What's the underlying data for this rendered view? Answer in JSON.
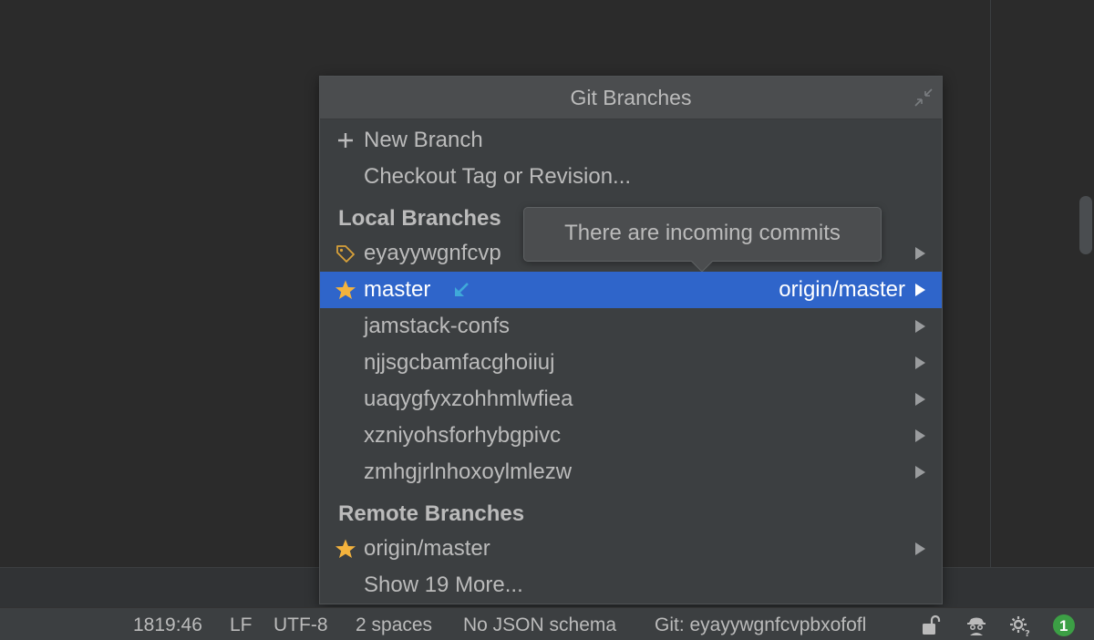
{
  "popup": {
    "title": "Git Branches",
    "actions": [
      {
        "label": "New Branch",
        "icon": "plus-icon"
      },
      {
        "label": "Checkout Tag or Revision..."
      }
    ],
    "local_section": "Local Branches",
    "local_branches": [
      {
        "name": "eyayywgnfcvp",
        "icon": "tag-icon"
      },
      {
        "name": "master",
        "icon": "star-icon",
        "tracking": "origin/master",
        "incoming": true,
        "selected": true
      },
      {
        "name": "jamstack-confs"
      },
      {
        "name": "njjsgcbamfacghoiiuj"
      },
      {
        "name": "uaqygfyxzohhmlwfiea"
      },
      {
        "name": "xzniyohsforhybgpivc"
      },
      {
        "name": "zmhgjrlnhoxoylmlezw"
      }
    ],
    "remote_section": "Remote Branches",
    "remote_branches": [
      {
        "name": "origin/master",
        "icon": "star-icon"
      }
    ],
    "show_more": "Show 19 More..."
  },
  "tooltip": {
    "text": "There are incoming commits"
  },
  "status_bar": {
    "position": "1819:46",
    "line_separator": "LF",
    "encoding": "UTF-8",
    "indent": "2 spaces",
    "json_schema": "No JSON schema",
    "git_branch": "Git: eyayywgnfcvpbxofofl",
    "notifications_count": "1"
  },
  "colors": {
    "selection": "#2f65ca",
    "star": "#f4b33d",
    "incoming": "#3fa9d9",
    "badge": "#3c9f45"
  }
}
